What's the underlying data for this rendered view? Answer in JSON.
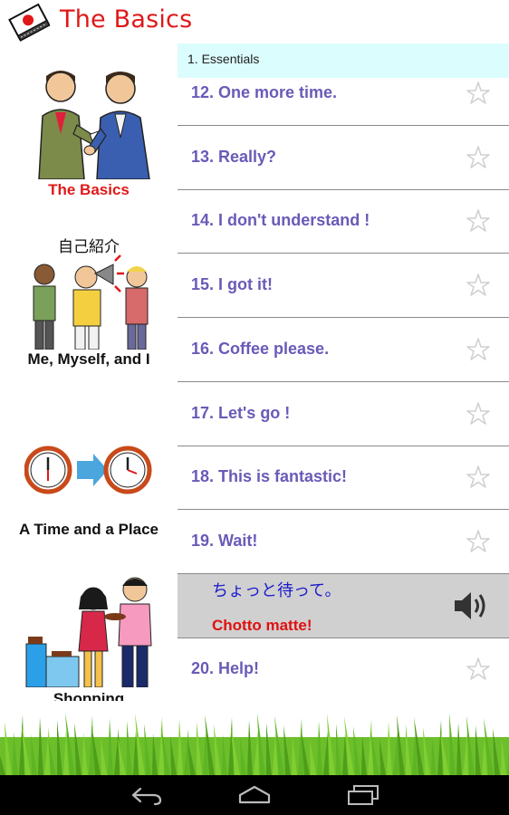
{
  "header": {
    "title": "The Basics",
    "icon": "japanese-flag-book-icon"
  },
  "categories": [
    {
      "label": "The Basics",
      "active": true,
      "icon": "handshake-people-image"
    },
    {
      "label": "Me, Myself, and I",
      "active": false,
      "icon": "self-introduction-image",
      "caption_jp": "自己紹介"
    },
    {
      "label": "A Time and a Place",
      "active": false,
      "icon": "clocks-image"
    },
    {
      "label": "Shopping",
      "active": false,
      "icon": "shopping-couple-image"
    }
  ],
  "section": {
    "title": "1. Essentials"
  },
  "phrases": [
    {
      "label": "12. One more time."
    },
    {
      "label": "13. Really?"
    },
    {
      "label": "14. I don't understand !"
    },
    {
      "label": "15. I got it!"
    },
    {
      "label": "16. Coffee please."
    },
    {
      "label": "17. Let's go !"
    },
    {
      "label": "18. This is fantastic!"
    },
    {
      "label": "19. Wait!"
    }
  ],
  "expanded": {
    "japanese": "ちょっと待って。",
    "romaji": "Chotto matte!",
    "icon": "speaker-icon"
  },
  "after_phrases": [
    {
      "label": "20. Help!"
    }
  ],
  "nav": {
    "back_icon": "back-icon",
    "home_icon": "home-icon",
    "recents_icon": "recents-icon"
  },
  "colors": {
    "title_red": "#e01818",
    "phrase_purple": "#6a5ab8",
    "section_bg": "#dcfdfd",
    "expanded_bg": "#d0d0d0",
    "japanese_blue": "#1a1acc"
  }
}
